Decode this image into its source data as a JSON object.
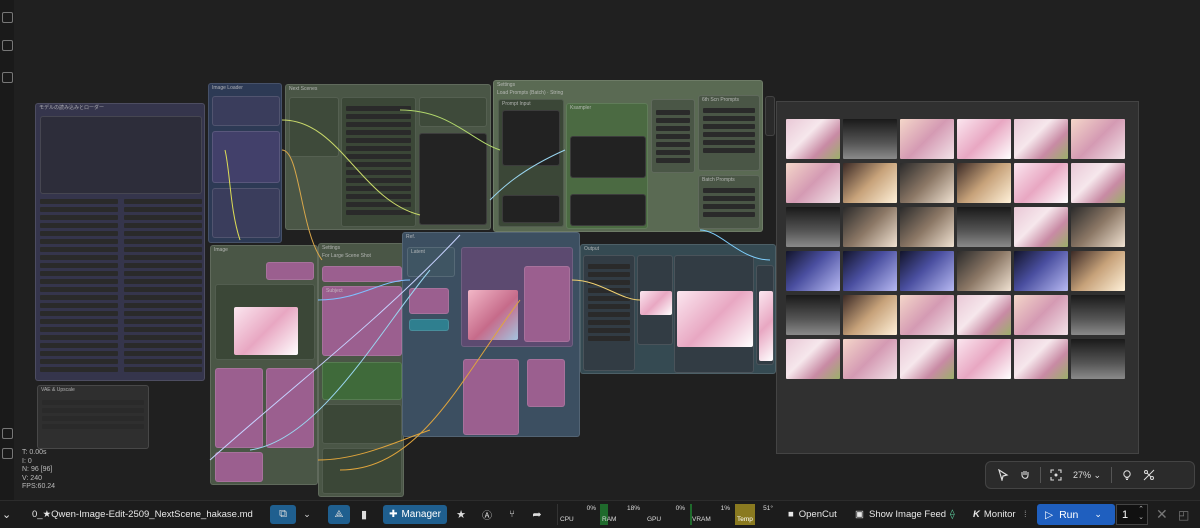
{
  "workflow": {
    "tab_name": "0_★Qwen-Image-Edit-2509_NextScene_hakase.md"
  },
  "canvas": {
    "nodes": {
      "loader_group_title": "モデルの読み込みとローダー",
      "image_loader_title": "Image Loader",
      "next_scene_title": "Next Scenes",
      "settings_title": "Settings",
      "settings_sub": "Load Prompts (Batch) · String",
      "prompt_input": "Prompt Input",
      "ksampler_title": "Ksampler",
      "six_scene_title": "6th Scn Prompts",
      "batch_prompts_title": "Batch Prompts",
      "image_title": "Image",
      "settings2_title": "Settings",
      "for_large": "For Large Scene Shot",
      "subject": "Subject",
      "ref_title": "Ref.",
      "latent": "Latent",
      "output_title": "Output",
      "grid_title": "Grid",
      "vae_title": "VAE & Upscale"
    },
    "gallery": {
      "rows": [
        [
          "c0",
          "c1",
          "c2",
          "c6",
          "c0",
          "c2"
        ],
        [
          "c2",
          "c5",
          "c3",
          "c5",
          "c6",
          "c0"
        ],
        [
          "c1",
          "c3",
          "c3",
          "c1",
          "c0",
          "c3"
        ],
        [
          "c4",
          "c4",
          "c4",
          "c3",
          "c4",
          "c5"
        ],
        [
          "c1",
          "c5",
          "c2",
          "c0",
          "c2",
          "c1"
        ],
        [
          "c0",
          "c2",
          "c0",
          "c6",
          "c0",
          "c1"
        ]
      ]
    },
    "hud": {
      "t": "T: 0.00s",
      "i": "I: 0",
      "n": "N: 96 [96]",
      "v": "V: 240",
      "fps": "FPS:60.24"
    },
    "zoom_toolbar": {
      "zoom_value": "27%",
      "zoom_caret": "⌄"
    }
  },
  "bottombar": {
    "manager_label": "Manager",
    "cpu_label": "CPU",
    "cpu_value": "0%",
    "ram_label": "RAM",
    "ram_value": "18%",
    "gpu_label": "GPU",
    "gpu_value": "0%",
    "vram_label": "VRAM",
    "vram_value": "1%",
    "temp_label": "Temp",
    "temp_value": "51°",
    "opencut_label": "OpenCut",
    "show_feed_label": "Show Image Feed",
    "monitor_label": "Monitor",
    "run_label": "Run",
    "batch_count": "1",
    "ram_fraction": 0.18,
    "vram_fraction": 0.01
  },
  "colors": {
    "accent_blue": "#1f5fbf",
    "node_pink": "#9b5f8f",
    "node_green": "#4b5a44",
    "node_violet": "#4a4a6a",
    "temp_yellow": "#8a7a20"
  }
}
